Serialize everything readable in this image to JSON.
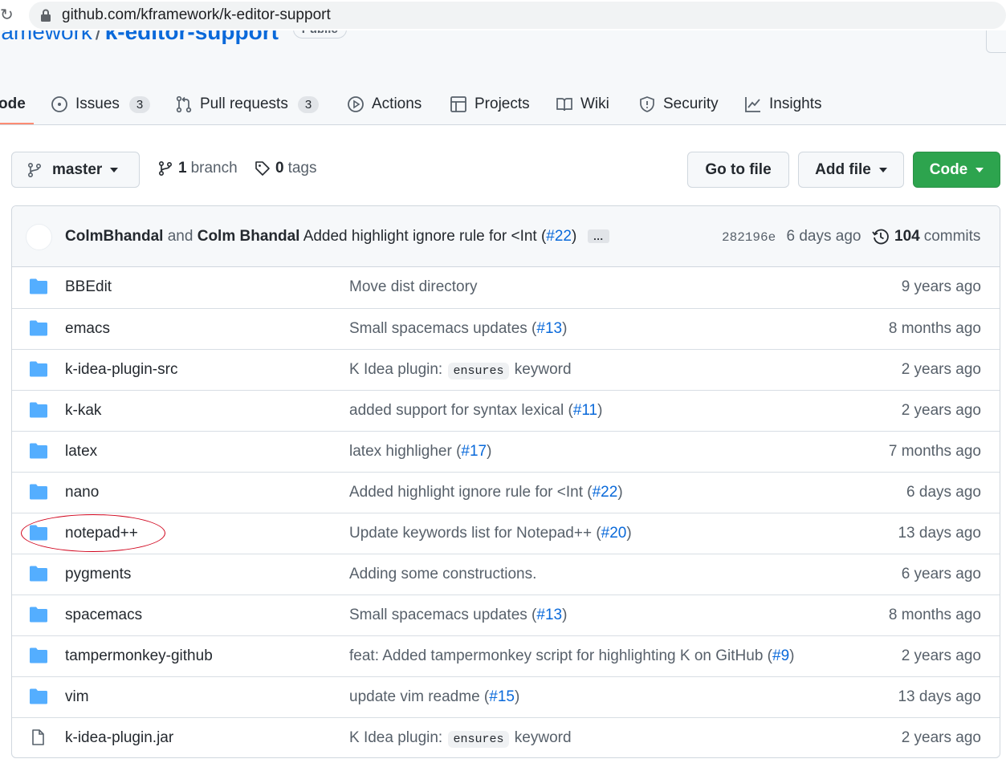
{
  "browser": {
    "url": "github.com/kframework/k-editor-support"
  },
  "repo": {
    "owner": "ramework",
    "separator": "/",
    "name": "k-editor-support",
    "visibility": "Public"
  },
  "tabs": [
    {
      "label": "ode",
      "icon": "code-icon"
    },
    {
      "label": "Issues",
      "count": "3",
      "icon": "issue-icon"
    },
    {
      "label": "Pull requests",
      "count": "3",
      "icon": "pull-request-icon"
    },
    {
      "label": "Actions",
      "icon": "play-icon"
    },
    {
      "label": "Projects",
      "icon": "table-icon"
    },
    {
      "label": "Wiki",
      "icon": "book-icon"
    },
    {
      "label": "Security",
      "icon": "shield-icon"
    },
    {
      "label": "Insights",
      "icon": "graph-icon"
    }
  ],
  "toolbar": {
    "branch_label": "master",
    "branches_count": "1",
    "branches_label": "branch",
    "tags_count": "0",
    "tags_label": "tags",
    "go_to_file": "Go to file",
    "add_file": "Add file",
    "code": "Code"
  },
  "latest_commit": {
    "author1": "ColmBhandal",
    "and": "and",
    "author2": "Colm Bhandal",
    "message": "Added highlight ignore rule for <Int (",
    "pr_link": "#22",
    "message_end": ")",
    "ellipsis": "…",
    "sha": "282196e",
    "age": "6 days ago",
    "commits_count": "104",
    "commits_label": "commits"
  },
  "files": [
    {
      "name": "BBEdit",
      "type": "dir",
      "msg": "Move dist directory",
      "age": "9 years ago"
    },
    {
      "name": "emacs",
      "type": "dir",
      "msg": "Small spacemacs updates (",
      "link": "#13",
      "msg_end": ")",
      "age": "8 months ago"
    },
    {
      "name": "k-idea-plugin-src",
      "type": "dir",
      "msg": "K Idea plugin:",
      "code": "ensures",
      "msg_end": "keyword",
      "age": "2 years ago"
    },
    {
      "name": "k-kak",
      "type": "dir",
      "msg": "added support for syntax lexical (",
      "link": "#11",
      "msg_end": ")",
      "age": "2 years ago"
    },
    {
      "name": "latex",
      "type": "dir",
      "msg": "latex highligher (",
      "link": "#17",
      "msg_end": ")",
      "age": "7 months ago"
    },
    {
      "name": "nano",
      "type": "dir",
      "msg": "Added highlight ignore rule for <Int (",
      "link": "#22",
      "msg_end": ")",
      "age": "6 days ago"
    },
    {
      "name": "notepad++",
      "type": "dir",
      "msg": "Update keywords list for Notepad++ (",
      "link": "#20",
      "msg_end": ")",
      "age": "13 days ago"
    },
    {
      "name": "pygments",
      "type": "dir",
      "msg": "Adding some constructions.",
      "age": "6 years ago"
    },
    {
      "name": "spacemacs",
      "type": "dir",
      "msg": "Small spacemacs updates (",
      "link": "#13",
      "msg_end": ")",
      "age": "8 months ago"
    },
    {
      "name": "tampermonkey-github",
      "type": "dir",
      "msg": "feat: Added tampermonkey script for highlighting K on GitHub (",
      "link": "#9",
      "msg_end": ")",
      "age": "2 years ago"
    },
    {
      "name": "vim",
      "type": "dir",
      "msg": "update vim readme (",
      "link": "#15",
      "msg_end": ")",
      "age": "13 days ago"
    },
    {
      "name": "k-idea-plugin.jar",
      "type": "file",
      "msg": "K Idea plugin:",
      "code": "ensures",
      "msg_end": "keyword",
      "age": "2 years ago"
    }
  ],
  "colors": {
    "link": "#0969da",
    "folder": "#54aeff",
    "primary_button": "#2da44e",
    "tab_underline": "#fd8c73",
    "annotation": "#d0021b"
  }
}
